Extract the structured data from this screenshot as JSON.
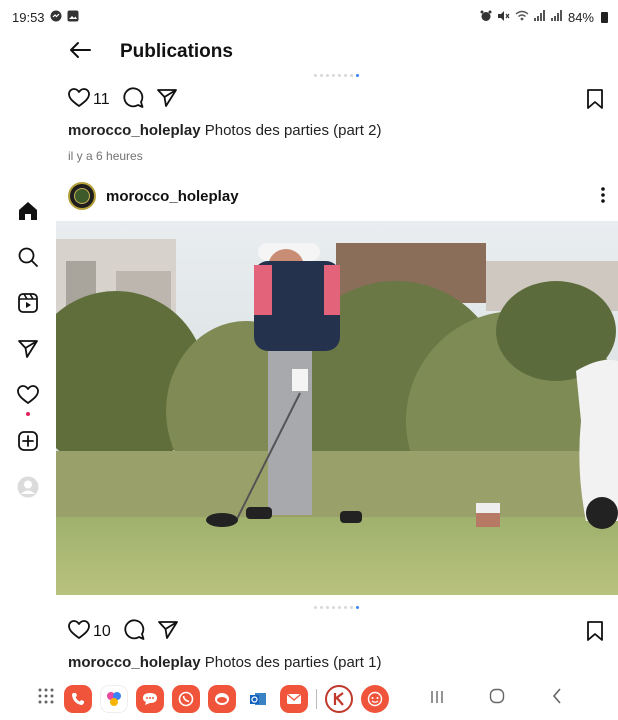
{
  "status": {
    "time": "19:53",
    "battery": "84%"
  },
  "header": {
    "back_icon": "arrow-left-icon",
    "title": "Publications"
  },
  "posts": [
    {
      "likes": "11",
      "username": "morocco_holeplay",
      "caption": "Photos des parties (part 2)",
      "time_ago": "il y a 6 heures"
    },
    {
      "username": "morocco_holeplay",
      "likes": "10",
      "caption": "Photos des parties (part 1)"
    }
  ],
  "sidebar": {
    "items": [
      {
        "name": "home-icon"
      },
      {
        "name": "search-icon"
      },
      {
        "name": "reels-icon"
      },
      {
        "name": "direct-messages-icon"
      },
      {
        "name": "notifications-icon"
      },
      {
        "name": "create-icon"
      },
      {
        "name": "profile-icon"
      }
    ]
  },
  "colors": {
    "accent_dot": "#3b82f6",
    "notification": "#e0245e"
  }
}
